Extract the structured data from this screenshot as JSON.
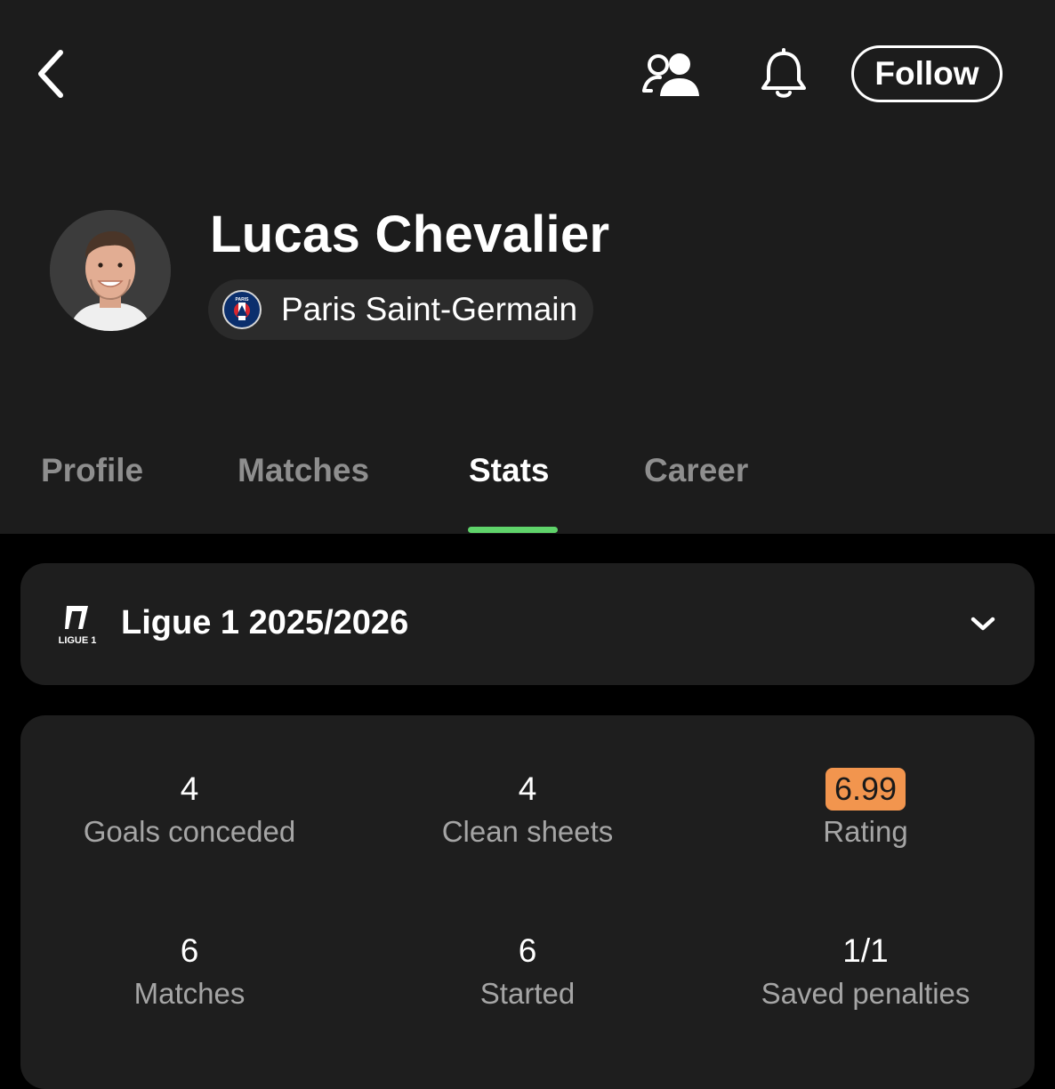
{
  "colors": {
    "header_bg": "#1c1c1c",
    "page_bg": "#000000",
    "card_bg": "#1e1e1e",
    "active_tab_indicator": "#5fd36a",
    "rating_badge": "#f2954e"
  },
  "topbar": {
    "back_icon": "chevron-left-icon",
    "compare_icon": "users-icon",
    "notify_icon": "bell-icon",
    "follow_label": "Follow"
  },
  "player": {
    "name": "Lucas Chevalier",
    "team": "Paris Saint-Germain",
    "team_logo_text": "PARIS"
  },
  "tabs": [
    {
      "label": "Profile",
      "active": false
    },
    {
      "label": "Matches",
      "active": false
    },
    {
      "label": "Stats",
      "active": true
    },
    {
      "label": "Career",
      "active": false
    }
  ],
  "competition": {
    "logo_text": "LIGUE 1",
    "label": "Ligue 1 2025/2026",
    "dropdown_icon": "chevron-down-icon"
  },
  "stats": [
    {
      "value": "4",
      "label": "Goals conceded"
    },
    {
      "value": "4",
      "label": "Clean sheets"
    },
    {
      "value": "6.99",
      "label": "Rating"
    },
    {
      "value": "6",
      "label": "Matches"
    },
    {
      "value": "6",
      "label": "Started"
    },
    {
      "value": "1/1",
      "label": "Saved penalties"
    }
  ]
}
